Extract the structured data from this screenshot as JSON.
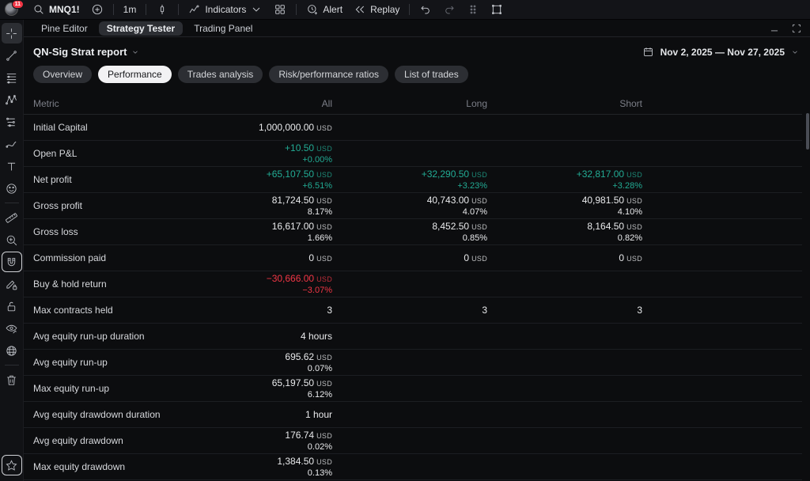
{
  "colors": {
    "green": "#22ab94",
    "red": "#f23645"
  },
  "toolbar": {
    "notification_count": "11",
    "symbol": "MNQ1!",
    "interval": "1m",
    "indicators_label": "Indicators",
    "alert_label": "Alert",
    "replay_label": "Replay"
  },
  "sidebar_tools": [
    "crosshair",
    "trend-line",
    "fib-retracement",
    "xabcd-pattern",
    "projection",
    "brush",
    "text",
    "emoji",
    "ruler",
    "zoom-in",
    "magnet",
    "drawing-lock",
    "lock-open",
    "hide-drawings",
    "globe",
    "trash",
    "favorites-star"
  ],
  "tabs": [
    {
      "label": "Pine Editor",
      "active": false
    },
    {
      "label": "Strategy Tester",
      "active": true
    },
    {
      "label": "Trading Panel",
      "active": false
    }
  ],
  "report": {
    "title": "QN-Sig Strat report",
    "date_range": "Nov 2, 2025 — Nov 27, 2025"
  },
  "view_pills": [
    {
      "label": "Overview",
      "active": false
    },
    {
      "label": "Performance",
      "active": true
    },
    {
      "label": "Trades analysis",
      "active": false
    },
    {
      "label": "Risk/performance ratios",
      "active": false
    },
    {
      "label": "List of trades",
      "active": false
    }
  ],
  "table": {
    "headers": [
      "Metric",
      "All",
      "Long",
      "Short"
    ],
    "rows": [
      {
        "metric": "Initial Capital",
        "all": {
          "value": "1,000,000.00",
          "currency": "USD"
        },
        "long": null,
        "short": null
      },
      {
        "metric": "Open P&L",
        "all": {
          "value": "+10.50",
          "currency": "USD",
          "pct": "+0.00%",
          "color": "green"
        },
        "long": null,
        "short": null
      },
      {
        "metric": "Net profit",
        "all": {
          "value": "+65,107.50",
          "currency": "USD",
          "pct": "+6.51%",
          "color": "green"
        },
        "long": {
          "value": "+32,290.50",
          "currency": "USD",
          "pct": "+3.23%",
          "color": "green"
        },
        "short": {
          "value": "+32,817.00",
          "currency": "USD",
          "pct": "+3.28%",
          "color": "green"
        }
      },
      {
        "metric": "Gross profit",
        "all": {
          "value": "81,724.50",
          "currency": "USD",
          "pct": "8.17%"
        },
        "long": {
          "value": "40,743.00",
          "currency": "USD",
          "pct": "4.07%"
        },
        "short": {
          "value": "40,981.50",
          "currency": "USD",
          "pct": "4.10%"
        }
      },
      {
        "metric": "Gross loss",
        "all": {
          "value": "16,617.00",
          "currency": "USD",
          "pct": "1.66%"
        },
        "long": {
          "value": "8,452.50",
          "currency": "USD",
          "pct": "0.85%"
        },
        "short": {
          "value": "8,164.50",
          "currency": "USD",
          "pct": "0.82%"
        }
      },
      {
        "metric": "Commission paid",
        "all": {
          "value": "0",
          "currency": "USD"
        },
        "long": {
          "value": "0",
          "currency": "USD"
        },
        "short": {
          "value": "0",
          "currency": "USD"
        }
      },
      {
        "metric": "Buy & hold return",
        "all": {
          "value": "−30,666.00",
          "currency": "USD",
          "pct": "−3.07%",
          "color": "red"
        },
        "long": null,
        "short": null
      },
      {
        "metric": "Max contracts held",
        "all": {
          "value": "3"
        },
        "long": {
          "value": "3"
        },
        "short": {
          "value": "3"
        }
      },
      {
        "metric": "Avg equity run-up duration",
        "all": {
          "value": "4 hours"
        },
        "long": null,
        "short": null
      },
      {
        "metric": "Avg equity run-up",
        "all": {
          "value": "695.62",
          "currency": "USD",
          "pct": "0.07%"
        },
        "long": null,
        "short": null
      },
      {
        "metric": "Max equity run-up",
        "all": {
          "value": "65,197.50",
          "currency": "USD",
          "pct": "6.12%"
        },
        "long": null,
        "short": null
      },
      {
        "metric": "Avg equity drawdown duration",
        "all": {
          "value": "1 hour"
        },
        "long": null,
        "short": null
      },
      {
        "metric": "Avg equity drawdown",
        "all": {
          "value": "176.74",
          "currency": "USD",
          "pct": "0.02%"
        },
        "long": null,
        "short": null
      },
      {
        "metric": "Max equity drawdown",
        "all": {
          "value": "1,384.50",
          "currency": "USD",
          "pct": "0.13%"
        },
        "long": null,
        "short": null
      }
    ]
  }
}
